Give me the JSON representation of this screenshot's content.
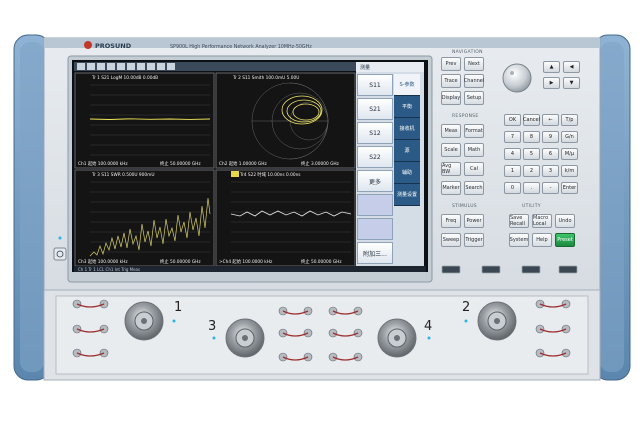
{
  "instrument": {
    "brand": "PROSUND",
    "model_line": "SP900L   High Performance Network Analyzer   10MHz-50GHz",
    "port_labels": [
      "1",
      "2",
      "3",
      "4"
    ]
  },
  "traces": [
    {
      "header": "Tr 1  S21 LogM 10.00dB 0.00dB",
      "footer_left": "Ch1  起始  100.0000 kHz",
      "footer_right": "终止  50.00000 GHz"
    },
    {
      "header": "Tr 2  S11 Smith 100.0mU  5.00U",
      "footer_left": "Ch2  起始  1.00000 GHz",
      "footer_right": "终止  3.00000 GHz"
    },
    {
      "header": "Tr 3  S11 SWR 0.500U  900mU",
      "footer_left": "Ch3  起始  100.0000 kHz",
      "footer_right": "终止  50.00000 GHz"
    },
    {
      "header": "Tr4  S22 时域  10.00ns  0.00ns",
      "footer_left": ">Ch4  起始  100.0000 kHz",
      "footer_right": "终止  50.00000 GHz"
    }
  ],
  "softkey_menu": {
    "title": "测量",
    "items": [
      "S11",
      "S21",
      "S12",
      "S22",
      "更多",
      "",
      "",
      "附加三..."
    ],
    "tabs": [
      "S-参数",
      "平衡",
      "接收机",
      "源",
      "辅助",
      "测量设置"
    ]
  },
  "status_bar": "Ch 1  Tr 1  LCL  Ch1  Int Trig  Meas",
  "front_panel": {
    "group_labels": [
      "NAVIGATION",
      "RESPONSE",
      "STIMULUS",
      "UTILITY"
    ],
    "nav_keys": [
      "Prev",
      "Next",
      "Trace",
      "Channel",
      "Display",
      "Setup"
    ],
    "response_keys": [
      "Meas",
      "Format",
      "Scale",
      "Math",
      "Avg BW",
      "Cal",
      "Marker",
      "Search"
    ],
    "stimulus_keys": [
      "Freq",
      "Power",
      "Sweep",
      "Trigger"
    ],
    "utility_keys": [
      "Save Recall",
      "Macro Local",
      "Undo",
      "System",
      "Help",
      "Preset"
    ],
    "numpad": [
      "OK",
      "Cancel",
      "←",
      "T/p",
      "7",
      "8",
      "9",
      "G/n",
      "4",
      "5",
      "6",
      "M/μ",
      "1",
      "2",
      "3",
      "k/m",
      "0",
      ".",
      "-",
      "Enter"
    ]
  }
}
